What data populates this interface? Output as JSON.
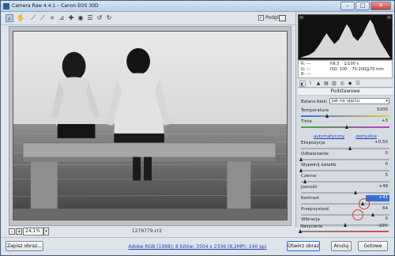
{
  "window": {
    "title": "Camera Raw 4.4.1 – Canon EOS 30D",
    "minimize": "–",
    "maximize": "□",
    "close": "✕"
  },
  "toolbar": {
    "preview_label": "Podgląd",
    "preview_checked": true
  },
  "image": {
    "filename": "1279779.cr2",
    "zoom": "24,1%",
    "zoom_out": "–",
    "zoom_in": "+"
  },
  "histogram": {
    "r_label": "R:",
    "g_label": "G:",
    "b_label": "B:",
    "r_value": "---",
    "g_value": "---",
    "b_value": "---"
  },
  "exif": {
    "aperture": "f/6,3",
    "shutter": "1/100 s",
    "iso": "ISO: 100",
    "lens": "70-200@70 mm"
  },
  "panel": {
    "section_title": "Podstawowe",
    "white_balance_label": "Balans bieli:",
    "white_balance_value": "Jak na ujęciu",
    "auto_link": "automatyczny",
    "default_link": "domyślne"
  },
  "sliders": {
    "temperature": {
      "label": "Temperatura",
      "value": "5200",
      "level": 0.3
    },
    "tint": {
      "label": "Tinta",
      "value": "+3",
      "level": 0.52
    },
    "exposure": {
      "label": "Ekspozycja",
      "value": "+0,50",
      "level": 0.56
    },
    "recovery": {
      "label": "Odtwarzanie",
      "value": "0",
      "level": 0.0
    },
    "fill_light": {
      "label": "Wypełnij światło",
      "value": "0",
      "level": 0.0
    },
    "blacks": {
      "label": "Czerne",
      "value": "5",
      "level": 0.05
    },
    "brightness": {
      "label": "Jasność",
      "value": "+49",
      "level": 0.62
    },
    "contrast": {
      "label": "Kontrast",
      "value": "+41",
      "level": 0.7
    },
    "clarity": {
      "label": "Przejrzystość",
      "value": "64",
      "level": 0.82
    },
    "vibrance": {
      "label": "Wibracja",
      "value": "0",
      "level": 0.5
    },
    "saturation": {
      "label": "Nasycenie",
      "value": "-100",
      "level": 0.0
    }
  },
  "bottom": {
    "save_label": "Zapisz obraz...",
    "workflow_info": "Adobe RGB (1998); 8 bitów; 3504 x 2336 (8,2MP); 240 ppi",
    "open_label": "Otwórz obraz",
    "cancel_label": "Anuluj",
    "done_label": "Gotowe"
  },
  "colors": {
    "selection": "#3a6fd0",
    "highlight": "#d43a3a",
    "link": "#1d3fbf"
  }
}
